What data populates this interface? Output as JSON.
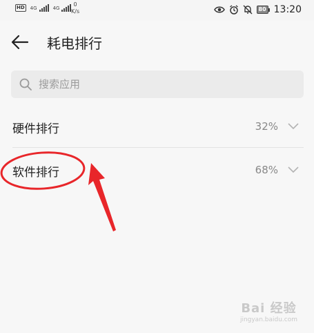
{
  "status_bar": {
    "hd_badge": "HD",
    "net_1": "4G",
    "net_2": "4G",
    "speed_value": "0",
    "speed_unit": "K/s",
    "battery": "80",
    "time": "13:20"
  },
  "header": {
    "title": "耗电排行"
  },
  "search": {
    "placeholder": "搜索应用"
  },
  "list": {
    "items": [
      {
        "label": "硬件排行",
        "value": "32%"
      },
      {
        "label": "软件排行",
        "value": "68%"
      }
    ]
  },
  "watermark": {
    "main": "Bai 经验",
    "sub": "jingyan.baidu.com"
  },
  "colors": {
    "annotation": "#e8262a"
  }
}
